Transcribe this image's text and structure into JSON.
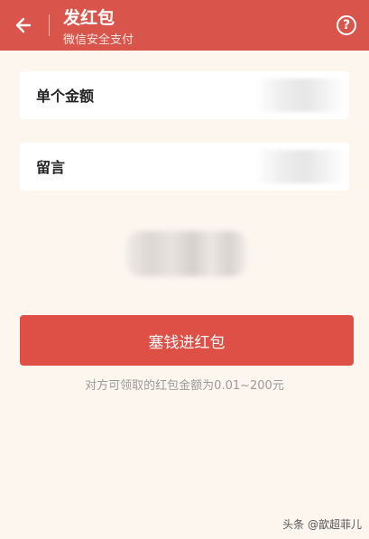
{
  "header": {
    "back_icon": "arrow-left-icon",
    "title": "发红包",
    "subtitle": "微信安全支付",
    "help_icon": "question-circle-icon",
    "help_symbol": "?",
    "background_color": "#d9544b"
  },
  "form": {
    "amount_label": "单个金额",
    "amount_value": "",
    "message_label": "留言",
    "message_value": ""
  },
  "submit_label": "塞钱进红包",
  "hint": "对方可领取的红包金额为0.01~200元",
  "watermark": "头条 @歆超菲儿",
  "colors": {
    "page_background": "#fcf6ef",
    "button": "#de4f45",
    "hint_text": "#9a9a9a"
  }
}
